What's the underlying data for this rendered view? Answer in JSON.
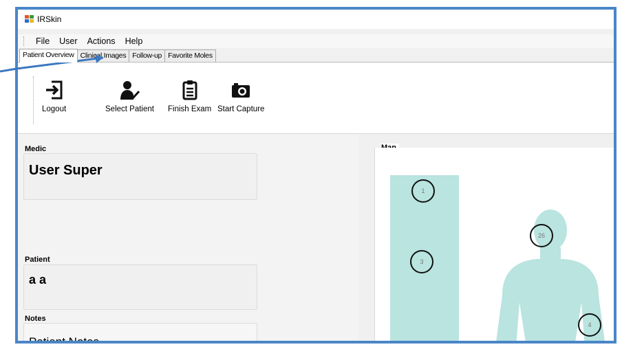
{
  "window": {
    "title": "IRSkin"
  },
  "menu": [
    "File",
    "User",
    "Actions",
    "Help"
  ],
  "tabs": [
    {
      "label": "Patient Overview",
      "active": true
    },
    {
      "label": "Clinical Images",
      "active": false
    },
    {
      "label": "Follow-up",
      "active": false
    },
    {
      "label": "Favorite Moles",
      "active": false
    }
  ],
  "toolbar": {
    "logout": {
      "label": "Logout",
      "icon": "logout-icon"
    },
    "select_patient": {
      "label": "Select Patient",
      "icon": "user-check-icon"
    },
    "finish_exam": {
      "label": "Finish Exam",
      "icon": "clipboard-icon"
    },
    "start_capture": {
      "label": "Start Capture",
      "icon": "camera-icon"
    }
  },
  "medic": {
    "label": "Medic",
    "value": "User Super"
  },
  "patient": {
    "label": "Patient",
    "value": "a a"
  },
  "notes": {
    "label": "Notes",
    "value": "Patient Notes"
  },
  "map": {
    "label": "Map",
    "markers": [
      "1",
      "3",
      "26",
      "4"
    ]
  },
  "colors": {
    "frame_border": "#4a86c8",
    "body_fill": "#b9e4df",
    "annotation_arrow": "#3c78c0"
  }
}
